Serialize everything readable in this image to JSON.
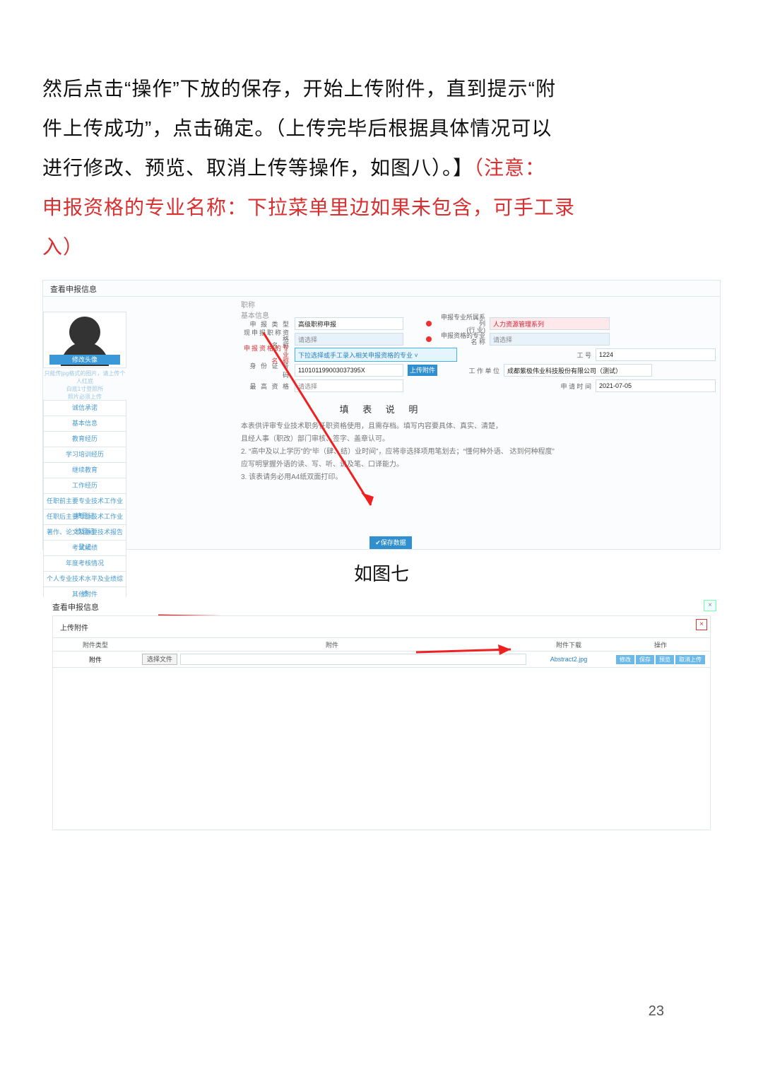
{
  "body_text": {
    "p1a": "然后点击“操作”下放的保存，开始上传附件，直到提示“附",
    "p1b": "件上传成功”，点击确定。（上传完毕后根据具体情况可以",
    "p1c_black": "进行修改、预览、取消上传等操作，如图八）。】",
    "p1c_red": "（注意：",
    "p2_red": "申报资格的专业名称：下拉菜单里边如果未包含，可手工录",
    "p3_red": "入）"
  },
  "fig1": {
    "title": "查看申报信息",
    "top_tabs": [
      "职称",
      "基本信息"
    ],
    "avatar_button": "修改头像",
    "avatar_note": "只能传jpg格式的图片，请上传个人红底\n白底1寸登照所\n照片必须上传",
    "side_items": [
      "诚信承诺",
      "基本信息",
      "教育经历",
      "学习培训经历",
      "继续教育",
      "工作经历",
      "任职前主要专业技术工作业绩登记",
      "任职后主要专业技术工作业绩登记",
      "著作、论文及重要技术报告登记",
      "考试成绩",
      "年度考核情况",
      "个人专业技术水平及业绩综述",
      "其他附件"
    ],
    "labels": {
      "sblx": "申  报  类  型",
      "sblx_v": "高级职称申报",
      "xsbzc": "现申报职称资格\n名                 称",
      "xsbzc_v": "请选择",
      "sbzy": "申报资格的专业\n名                 称",
      "sbzy_v": "下拉选择或手工录入相关申报资格的专业  ˅",
      "sfz": "身 份 证 号 码",
      "sfz_v": "110101199003037395X",
      "zg": "最  高  资  格",
      "zg_v": "请选择",
      "up_btn": "上传附件",
      "r_xl": "申报专业所属系列\n(行                    业)",
      "r_xl_v": "人力资源管理系列",
      "r_zy": "申报资格的专业\n名                   称",
      "r_zy_v": "请选择",
      "r_gh": "工                    号",
      "r_gh_v": "1224",
      "r_dw": "工   作   单   位",
      "r_dw_v": "成都紫极伟业科技股份有限公司（测试）",
      "r_sj": "申   请   时   间",
      "r_sj_v": "2021-07-05"
    },
    "fill_title": "填  表  说  明",
    "fill_lines": [
      "本表供评审专业技术职务任职资格使用，且需存档。填写内容要具体、真实、清楚，",
      "且经人事（职改）部门审核、签字、盖章认可。",
      "2.  “高中及以上学历”的“毕（肆、结）业时间”，应将非选择项用笔划去；“懂何种外语、  达到何种程度”",
      "应写明掌握外语的读、写、听、说及笔、口译能力。",
      "3.  该表请务必用A4纸双面打印。"
    ],
    "save_btn": "✔保存数据",
    "caption": "如图七"
  },
  "fig2": {
    "outer_title": "查看申报信息",
    "sub_title": "上传附件",
    "close": "×",
    "headers": [
      "附件类型",
      "附件",
      "附件下载",
      "操作"
    ],
    "row": {
      "type": "附件",
      "choose": "选择文件",
      "download": "Abstract2.jpg",
      "ops": [
        "修改",
        "保存",
        "预览",
        "取消上传"
      ]
    }
  },
  "page_number": "23",
  "chart_data": null
}
